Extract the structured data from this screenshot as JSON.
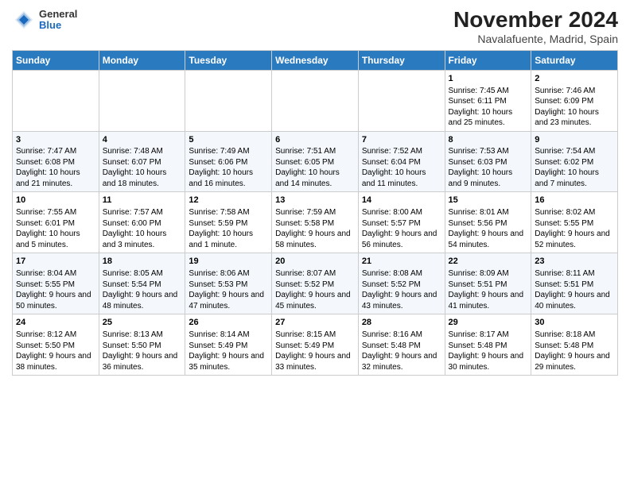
{
  "header": {
    "logo_general": "General",
    "logo_blue": "Blue",
    "title": "November 2024",
    "subtitle": "Navalafuente, Madrid, Spain"
  },
  "calendar": {
    "headers": [
      "Sunday",
      "Monday",
      "Tuesday",
      "Wednesday",
      "Thursday",
      "Friday",
      "Saturday"
    ],
    "weeks": [
      {
        "days": [
          {
            "date": "",
            "info": ""
          },
          {
            "date": "",
            "info": ""
          },
          {
            "date": "",
            "info": ""
          },
          {
            "date": "",
            "info": ""
          },
          {
            "date": "",
            "info": ""
          },
          {
            "date": "1",
            "info": "Sunrise: 7:45 AM\nSunset: 6:11 PM\nDaylight: 10 hours and 25 minutes."
          },
          {
            "date": "2",
            "info": "Sunrise: 7:46 AM\nSunset: 6:09 PM\nDaylight: 10 hours and 23 minutes."
          }
        ]
      },
      {
        "days": [
          {
            "date": "3",
            "info": "Sunrise: 7:47 AM\nSunset: 6:08 PM\nDaylight: 10 hours and 21 minutes."
          },
          {
            "date": "4",
            "info": "Sunrise: 7:48 AM\nSunset: 6:07 PM\nDaylight: 10 hours and 18 minutes."
          },
          {
            "date": "5",
            "info": "Sunrise: 7:49 AM\nSunset: 6:06 PM\nDaylight: 10 hours and 16 minutes."
          },
          {
            "date": "6",
            "info": "Sunrise: 7:51 AM\nSunset: 6:05 PM\nDaylight: 10 hours and 14 minutes."
          },
          {
            "date": "7",
            "info": "Sunrise: 7:52 AM\nSunset: 6:04 PM\nDaylight: 10 hours and 11 minutes."
          },
          {
            "date": "8",
            "info": "Sunrise: 7:53 AM\nSunset: 6:03 PM\nDaylight: 10 hours and 9 minutes."
          },
          {
            "date": "9",
            "info": "Sunrise: 7:54 AM\nSunset: 6:02 PM\nDaylight: 10 hours and 7 minutes."
          }
        ]
      },
      {
        "days": [
          {
            "date": "10",
            "info": "Sunrise: 7:55 AM\nSunset: 6:01 PM\nDaylight: 10 hours and 5 minutes."
          },
          {
            "date": "11",
            "info": "Sunrise: 7:57 AM\nSunset: 6:00 PM\nDaylight: 10 hours and 3 minutes."
          },
          {
            "date": "12",
            "info": "Sunrise: 7:58 AM\nSunset: 5:59 PM\nDaylight: 10 hours and 1 minute."
          },
          {
            "date": "13",
            "info": "Sunrise: 7:59 AM\nSunset: 5:58 PM\nDaylight: 9 hours and 58 minutes."
          },
          {
            "date": "14",
            "info": "Sunrise: 8:00 AM\nSunset: 5:57 PM\nDaylight: 9 hours and 56 minutes."
          },
          {
            "date": "15",
            "info": "Sunrise: 8:01 AM\nSunset: 5:56 PM\nDaylight: 9 hours and 54 minutes."
          },
          {
            "date": "16",
            "info": "Sunrise: 8:02 AM\nSunset: 5:55 PM\nDaylight: 9 hours and 52 minutes."
          }
        ]
      },
      {
        "days": [
          {
            "date": "17",
            "info": "Sunrise: 8:04 AM\nSunset: 5:55 PM\nDaylight: 9 hours and 50 minutes."
          },
          {
            "date": "18",
            "info": "Sunrise: 8:05 AM\nSunset: 5:54 PM\nDaylight: 9 hours and 48 minutes."
          },
          {
            "date": "19",
            "info": "Sunrise: 8:06 AM\nSunset: 5:53 PM\nDaylight: 9 hours and 47 minutes."
          },
          {
            "date": "20",
            "info": "Sunrise: 8:07 AM\nSunset: 5:52 PM\nDaylight: 9 hours and 45 minutes."
          },
          {
            "date": "21",
            "info": "Sunrise: 8:08 AM\nSunset: 5:52 PM\nDaylight: 9 hours and 43 minutes."
          },
          {
            "date": "22",
            "info": "Sunrise: 8:09 AM\nSunset: 5:51 PM\nDaylight: 9 hours and 41 minutes."
          },
          {
            "date": "23",
            "info": "Sunrise: 8:11 AM\nSunset: 5:51 PM\nDaylight: 9 hours and 40 minutes."
          }
        ]
      },
      {
        "days": [
          {
            "date": "24",
            "info": "Sunrise: 8:12 AM\nSunset: 5:50 PM\nDaylight: 9 hours and 38 minutes."
          },
          {
            "date": "25",
            "info": "Sunrise: 8:13 AM\nSunset: 5:50 PM\nDaylight: 9 hours and 36 minutes."
          },
          {
            "date": "26",
            "info": "Sunrise: 8:14 AM\nSunset: 5:49 PM\nDaylight: 9 hours and 35 minutes."
          },
          {
            "date": "27",
            "info": "Sunrise: 8:15 AM\nSunset: 5:49 PM\nDaylight: 9 hours and 33 minutes."
          },
          {
            "date": "28",
            "info": "Sunrise: 8:16 AM\nSunset: 5:48 PM\nDaylight: 9 hours and 32 minutes."
          },
          {
            "date": "29",
            "info": "Sunrise: 8:17 AM\nSunset: 5:48 PM\nDaylight: 9 hours and 30 minutes."
          },
          {
            "date": "30",
            "info": "Sunrise: 8:18 AM\nSunset: 5:48 PM\nDaylight: 9 hours and 29 minutes."
          }
        ]
      }
    ]
  }
}
